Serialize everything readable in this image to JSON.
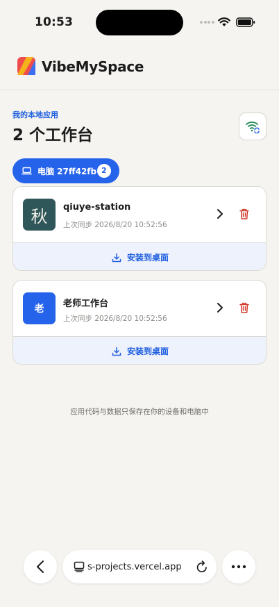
{
  "status_bar": {
    "time": "10:53"
  },
  "header": {
    "brand": "VibeMySpace"
  },
  "section": {
    "eyebrow": "我的本地应用",
    "title": "2 个工作台"
  },
  "device": {
    "label": "电脑 27ff42fb",
    "count": "2"
  },
  "apps": [
    {
      "icon_glyph": "秋",
      "name": "qiuye-station",
      "last_sync": "上次同步 2026/8/20 10:52:56",
      "install_label": "安装到桌面"
    },
    {
      "icon_glyph": "老",
      "name": "老师工作台",
      "last_sync": "上次同步 2026/8/20 10:52:56",
      "install_label": "安装到桌面"
    }
  ],
  "footer": {
    "note": "应用代码与数据只保存在你的设备和电脑中"
  },
  "browser": {
    "url": "s-projects.vercel.app"
  },
  "colors": {
    "accent": "#2563eb",
    "danger": "#d33a2c",
    "app_icon_teal": "#2f5658",
    "background": "#f5f4f0"
  },
  "icons": [
    "wifi-icon",
    "battery-icon",
    "logo-icon",
    "wifi-sync-icon",
    "laptop-icon",
    "chevron-right-icon",
    "trash-icon",
    "download-icon",
    "back-icon",
    "tabs-icon",
    "reload-icon",
    "more-icon"
  ]
}
